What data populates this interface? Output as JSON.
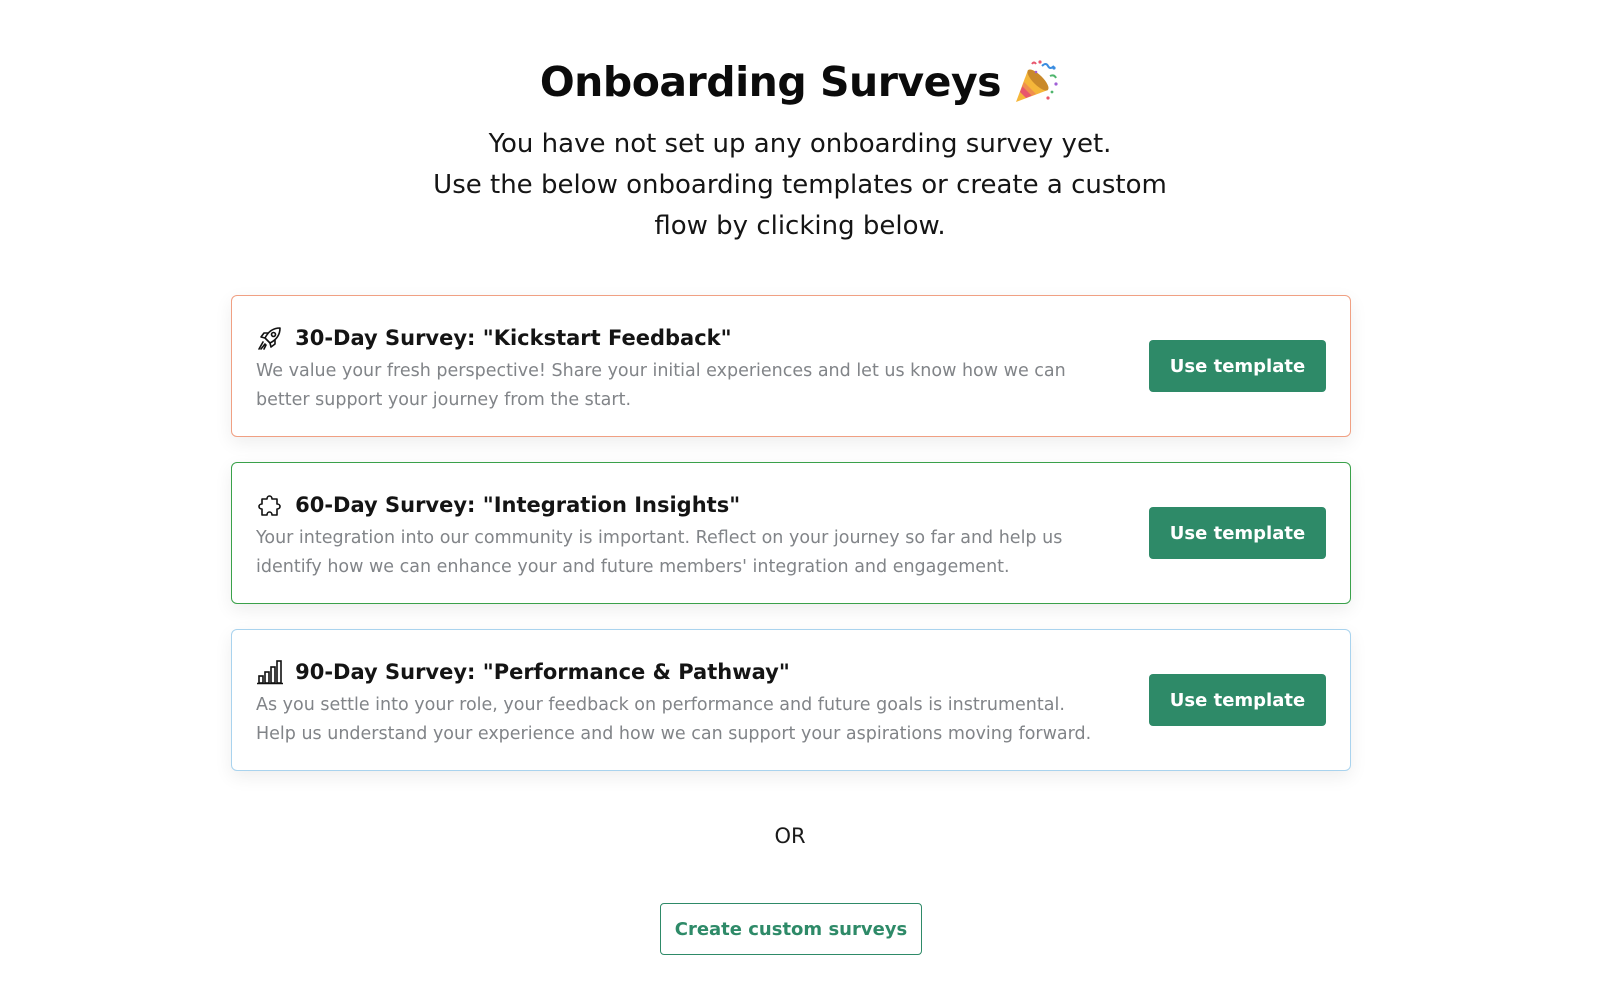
{
  "header": {
    "title": "Onboarding Surveys",
    "title_icon": "party-popper-icon",
    "subtitle_lines": [
      "You have not set up any onboarding survey yet.",
      "Use the below onboarding templates or create a custom",
      "flow by clicking below."
    ]
  },
  "templates": [
    {
      "icon": "rocket-icon",
      "title": "30-Day Survey: \"Kickstart Feedback\"",
      "description_lines": [
        "We value your fresh perspective! Share your initial experiences and let us know how we can",
        "better support your journey from the start."
      ],
      "button_label": "Use template",
      "border_color": "#f0a083"
    },
    {
      "icon": "puzzle-icon",
      "title": "60-Day Survey: \"Integration Insights\"",
      "description_lines": [
        "Your integration into our community is important. Reflect on your journey so far and help us",
        "identify how we can enhance your and future members' integration and engagement."
      ],
      "button_label": "Use template",
      "border_color": "#3aa14a"
    },
    {
      "icon": "bar-chart-icon",
      "title": "90-Day Survey: \"Performance & Pathway\"",
      "description_lines": [
        "As you settle into your role, your feedback on performance and future goals is instrumental.",
        "Help us understand your experience and how we can support your aspirations moving forward."
      ],
      "button_label": "Use template",
      "border_color": "#a9d3ee"
    }
  ],
  "divider_text": "OR",
  "custom_button_label": "Create custom surveys",
  "colors": {
    "accent": "#2e8a68",
    "description_text": "#818488"
  }
}
